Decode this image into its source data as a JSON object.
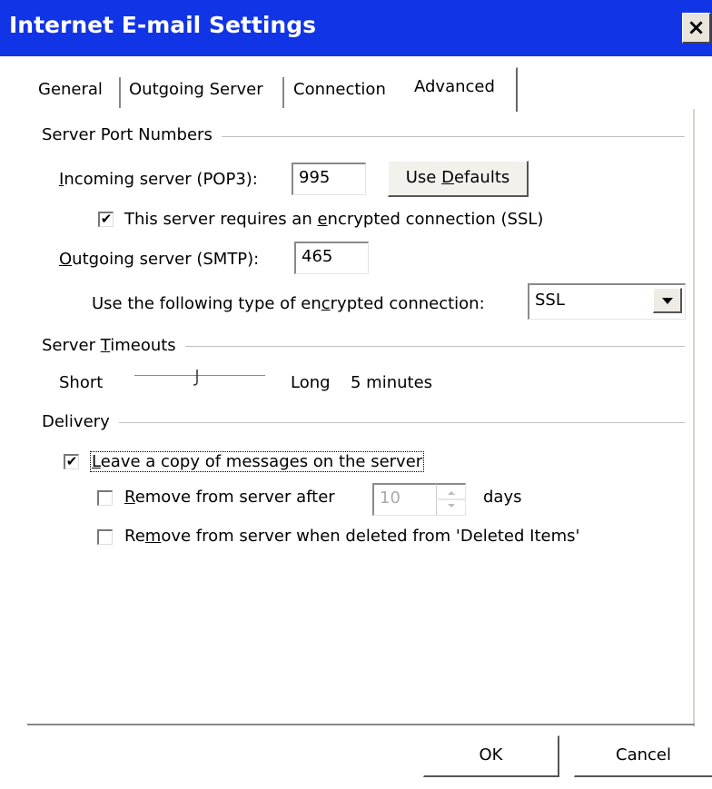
{
  "window": {
    "title": "Internet E-mail Settings",
    "close_glyph": "×"
  },
  "tabs": [
    {
      "label": "General",
      "active": false
    },
    {
      "label": "Outgoing Server",
      "active": false
    },
    {
      "label": "Connection",
      "active": false
    },
    {
      "label": "Advanced",
      "active": true
    }
  ],
  "server_ports": {
    "group_title": "Server Port Numbers",
    "incoming_label_pre": "",
    "incoming_label_mn": "I",
    "incoming_label_post": "ncoming server (POP3):",
    "incoming_value": "995",
    "use_defaults_pre": "Use ",
    "use_defaults_mn": "D",
    "use_defaults_post": "efaults",
    "ssl_checkbox_pre": "This server requires an ",
    "ssl_checkbox_mn": "e",
    "ssl_checkbox_post": "ncrypted connection (SSL)",
    "ssl_checked": true,
    "outgoing_label_mn": "O",
    "outgoing_label_post": "utgoing server (SMTP):",
    "outgoing_value": "465",
    "encryption_label_pre": "Use the following type of en",
    "encryption_label_mn": "c",
    "encryption_label_post": "rypted connection:",
    "encryption_value": "SSL"
  },
  "timeouts": {
    "group_title_pre": "Server ",
    "group_title_mn": "T",
    "group_title_post": "imeouts",
    "short_label": "Short",
    "long_label": "Long",
    "value_text": "5 minutes",
    "slider_fraction": 0.45
  },
  "delivery": {
    "group_title": "Delivery",
    "leave_copy_mn": "L",
    "leave_copy_post": "eave a copy of messages on the server",
    "leave_copy_checked": true,
    "remove_after_mn": "R",
    "remove_after_post": "emove from server after",
    "remove_after_checked": false,
    "days_value": "10",
    "days_label": "days",
    "remove_deleted_pre": "Re",
    "remove_deleted_mn": "m",
    "remove_deleted_post": "ove from server when deleted from 'Deleted Items'",
    "remove_deleted_checked": false
  },
  "footer": {
    "ok_label": "OK",
    "cancel_label": "Cancel"
  },
  "check_glyph": "✔"
}
